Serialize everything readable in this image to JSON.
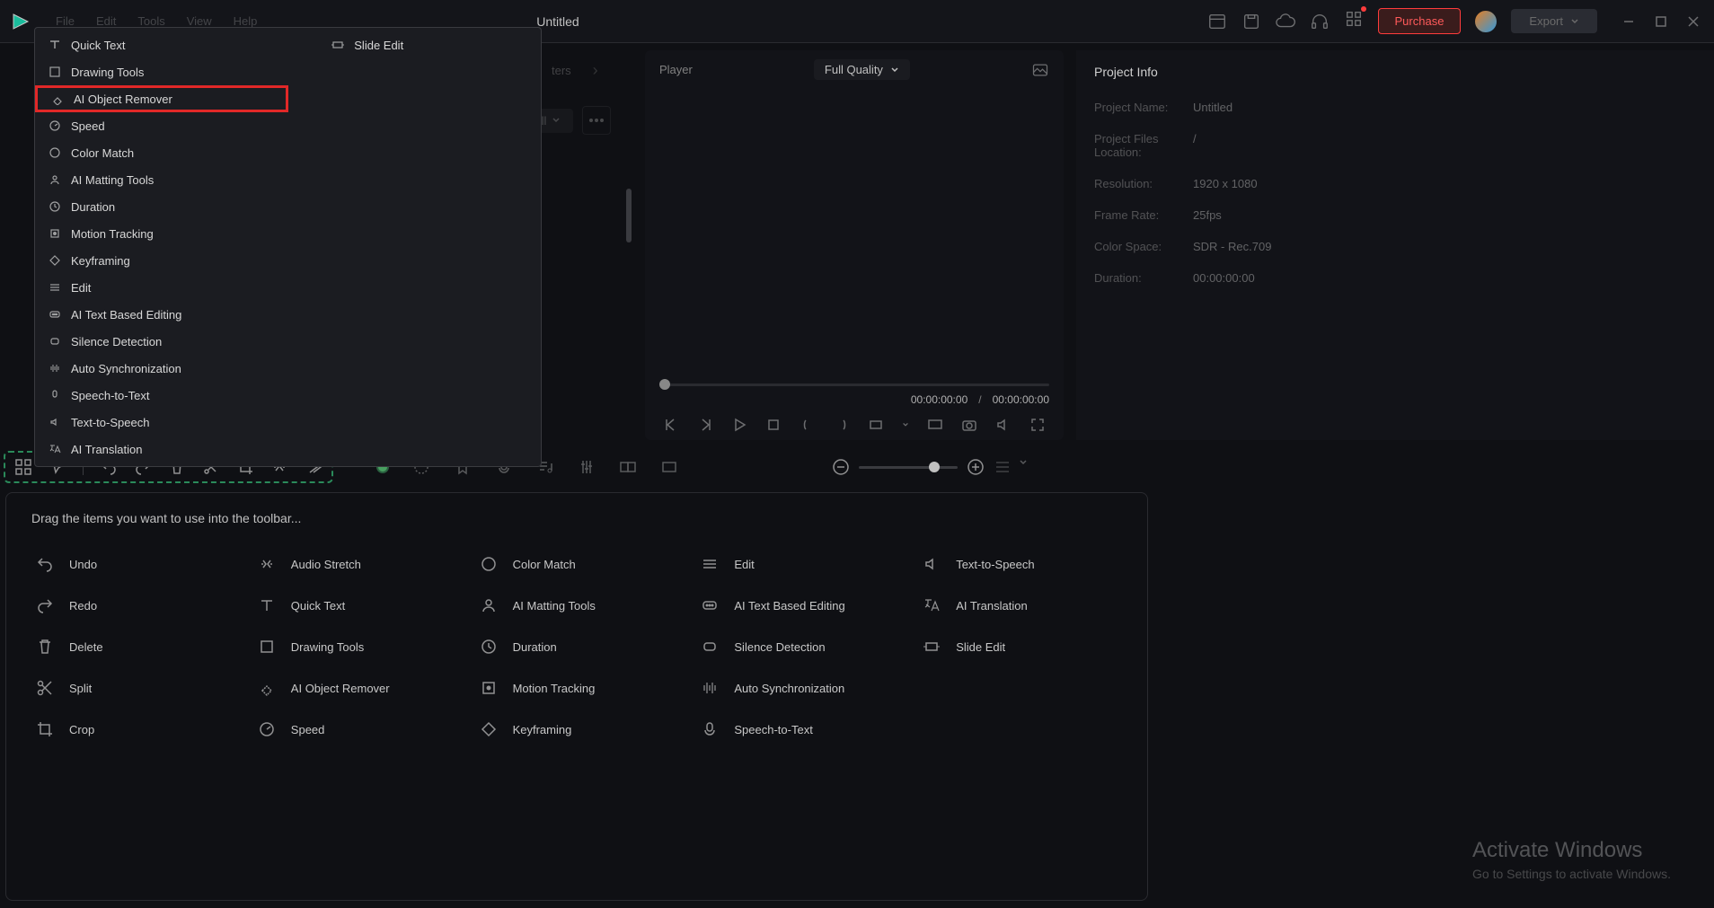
{
  "app": {
    "title": "Untitled"
  },
  "menu": [
    "File",
    "Edit",
    "Tools",
    "View",
    "Help"
  ],
  "top_buttons": {
    "purchase": "Purchase",
    "export": "Export"
  },
  "dropdown": {
    "quick_text": "Quick Text",
    "slide_edit": "Slide Edit",
    "drawing_tools": "Drawing Tools",
    "ai_object_remover": "AI Object Remover",
    "speed": "Speed",
    "color_match": "Color Match",
    "ai_matting_tools": "AI Matting Tools",
    "duration": "Duration",
    "motion_tracking": "Motion Tracking",
    "keyframing": "Keyframing",
    "edit": "Edit",
    "ai_text_based_editing": "AI Text Based Editing",
    "silence_detection": "Silence Detection",
    "auto_synchronization": "Auto Synchronization",
    "speech_to_text": "Speech-to-Text",
    "text_to_speech": "Text-to-Speech",
    "ai_translation": "AI Translation"
  },
  "tabs": {
    "filters": "ters"
  },
  "filter": {
    "all": "All"
  },
  "player": {
    "label": "Player",
    "quality": "Full Quality",
    "time_current": "00:00:00:00",
    "time_sep": "/",
    "time_total": "00:00:00:00"
  },
  "project": {
    "title": "Project Info",
    "name_label": "Project Name:",
    "name_value": "Untitled",
    "loc_label": "Project Files Location:",
    "loc_value": "/",
    "resolution_label": "Resolution:",
    "resolution_value": "1920 x 1080",
    "framerate_label": "Frame Rate:",
    "framerate_value": "25fps",
    "colorspace_label": "Color Space:",
    "colorspace_value": "SDR - Rec.709",
    "duration_label": "Duration:",
    "duration_value": "00:00:00:00"
  },
  "customize": {
    "title": "Drag the items you want to use into the toolbar...",
    "tools": {
      "undo": "Undo",
      "redo": "Redo",
      "delete": "Delete",
      "split": "Split",
      "crop": "Crop",
      "audio_stretch": "Audio Stretch",
      "quick_text": "Quick Text",
      "drawing_tools": "Drawing Tools",
      "ai_object_remover": "AI Object Remover",
      "speed": "Speed",
      "color_match": "Color Match",
      "ai_matting_tools": "AI Matting Tools",
      "duration": "Duration",
      "motion_tracking": "Motion Tracking",
      "keyframing": "Keyframing",
      "edit": "Edit",
      "ai_text_based_editing": "AI Text Based Editing",
      "silence_detection": "Silence Detection",
      "auto_synchronization": "Auto Synchronization",
      "speech_to_text": "Speech-to-Text",
      "text_to_speech": "Text-to-Speech",
      "ai_translation": "AI Translation",
      "slide_edit": "Slide Edit"
    }
  },
  "watermark": {
    "title": "Activate Windows",
    "sub": "Go to Settings to activate Windows."
  }
}
